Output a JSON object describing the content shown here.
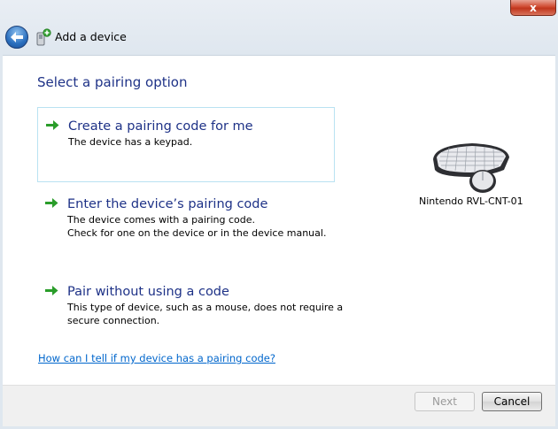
{
  "window": {
    "title": "Add a device",
    "close_glyph": "x",
    "close_icon": "close-icon",
    "back_icon": "back-arrow-icon",
    "title_icon": "add-device-icon"
  },
  "main": {
    "heading": "Select a pairing option",
    "options": [
      {
        "title": "Create a pairing code for me",
        "desc": [
          "The device has a keypad."
        ],
        "icon": "green-arrow-icon",
        "selected": true
      },
      {
        "title": "Enter the device’s pairing code",
        "desc": [
          "The device comes with a pairing code.",
          "Check for one on the device or in the device manual."
        ],
        "icon": "green-arrow-icon",
        "selected": false
      },
      {
        "title": "Pair without using a code",
        "desc": [
          "This type of device, such as a mouse, does not require a",
          "secure connection."
        ],
        "icon": "green-arrow-icon",
        "selected": false
      }
    ],
    "help_link": "How can I tell if my device has a pairing code?"
  },
  "device": {
    "name": "Nintendo RVL-CNT-01",
    "icon": "keyboard-mouse-icon"
  },
  "footer": {
    "next_label": "Next",
    "cancel_label": "Cancel"
  },
  "colors": {
    "heading": "#1e3287",
    "link": "#0066cc",
    "selection_border": "#b9e2f2",
    "arrow": "#2a9d2a"
  }
}
